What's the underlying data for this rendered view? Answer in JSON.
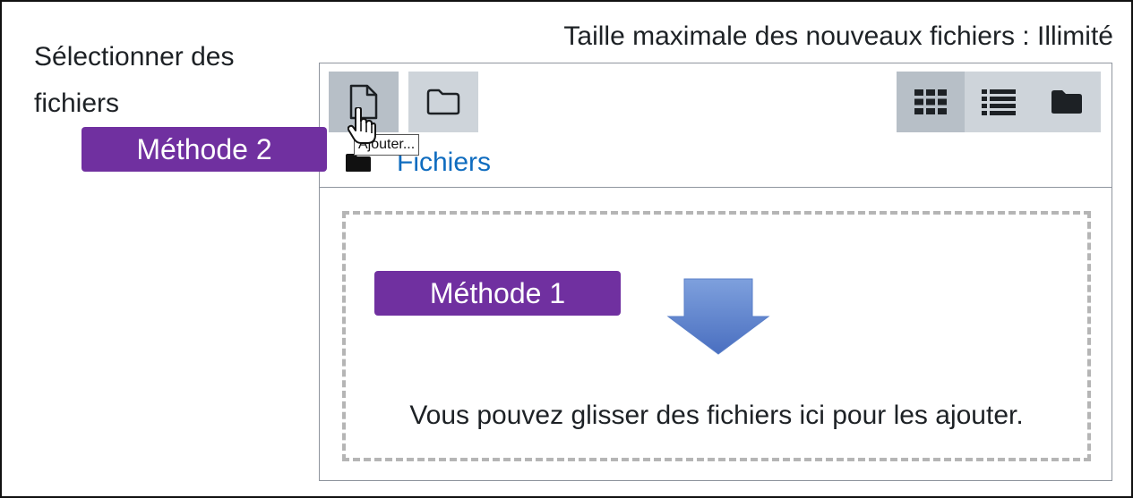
{
  "field": {
    "label": "Sélectionner des fichiers"
  },
  "filepicker": {
    "max_size": "Taille maximale des nouveaux fichiers : Illimité",
    "toolbar": {
      "add_icon": "file-icon",
      "folder_icon": "folder-icon",
      "views": [
        {
          "icon": "grid-view-icon",
          "active": true
        },
        {
          "icon": "list-view-icon",
          "active": false
        },
        {
          "icon": "tree-view-icon",
          "active": false
        }
      ]
    },
    "tooltip": "Ajouter...",
    "breadcrumb": {
      "icon": "folder-icon",
      "label": "Fichiers"
    },
    "dropzone": {
      "icon": "down-arrow-icon",
      "text": "Vous pouvez glisser des fichiers ici pour les ajouter."
    }
  },
  "annotations": {
    "method2": "Méthode 2",
    "method1": "Méthode 1",
    "color": "#7030a0"
  },
  "colors": {
    "link": "#0f6cbf",
    "button_bg": "#ced4da",
    "button_active_bg": "#b7bfc7",
    "arrow": "#5b80c9"
  }
}
